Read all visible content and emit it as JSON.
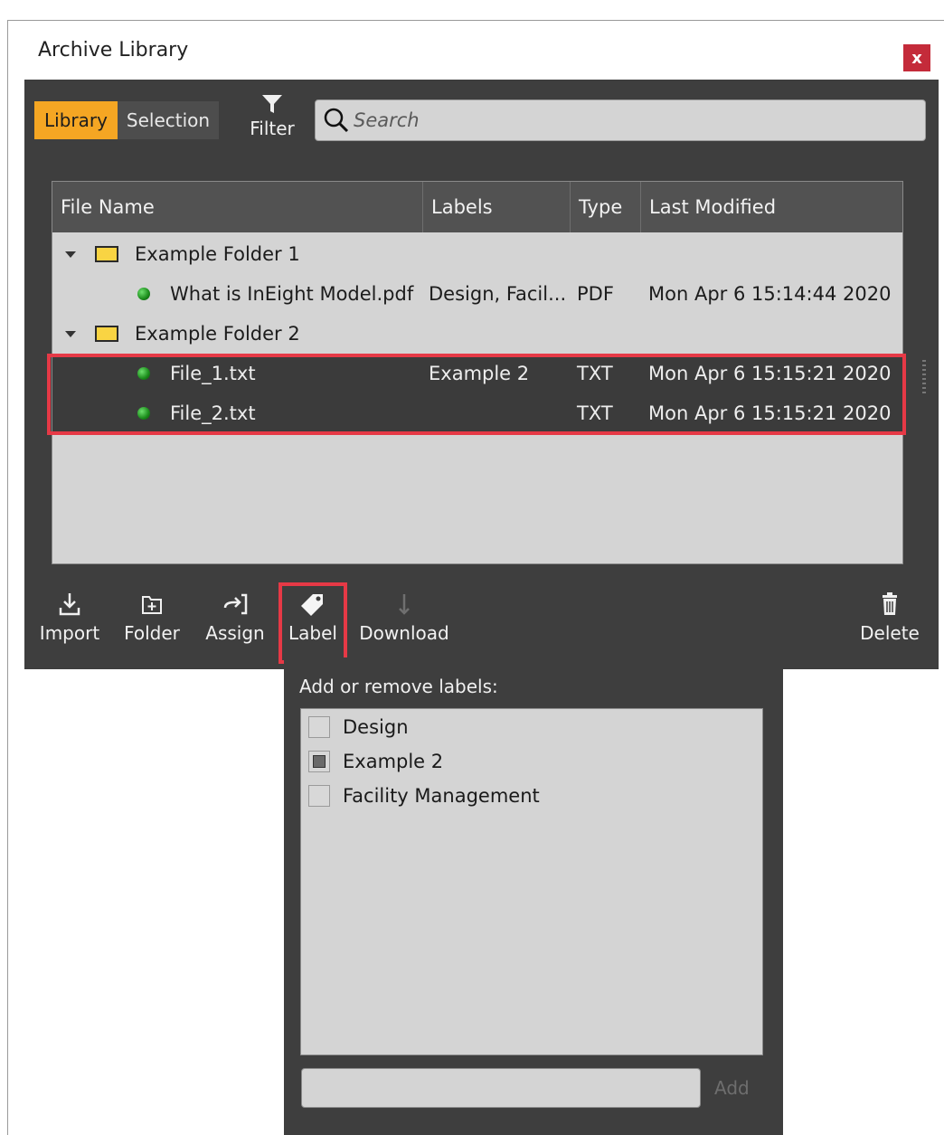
{
  "window": {
    "title": "Archive Library",
    "close_label": "x"
  },
  "tabs": [
    {
      "label": "Library",
      "active": true
    },
    {
      "label": "Selection",
      "active": false
    }
  ],
  "filter": {
    "label": "Filter",
    "icon": "filter-icon"
  },
  "search": {
    "placeholder": "Search",
    "value": ""
  },
  "table": {
    "columns": [
      "File Name",
      "Labels",
      "Type",
      "Last Modified"
    ],
    "rows": [
      {
        "kind": "folder",
        "name": "Example Folder 1",
        "labels": "",
        "type": "",
        "modified": ""
      },
      {
        "kind": "file",
        "name": "What is InEight Model.pdf",
        "labels": "Design, Facil...",
        "type": "PDF",
        "modified": "Mon Apr 6 15:14:44 2020"
      },
      {
        "kind": "folder",
        "name": "Example Folder 2",
        "labels": "",
        "type": "",
        "modified": ""
      },
      {
        "kind": "file",
        "name": "File_1.txt",
        "labels": "Example 2",
        "type": "TXT",
        "modified": "Mon Apr 6 15:15:21 2020",
        "selected": true
      },
      {
        "kind": "file",
        "name": "File_2.txt",
        "labels": "",
        "type": "TXT",
        "modified": "Mon Apr 6 15:15:21 2020",
        "selected": true
      }
    ]
  },
  "toolbar": {
    "import_label": "Import",
    "folder_label": "Folder",
    "assign_label": "Assign",
    "label_label": "Label",
    "download_label": "Download",
    "delete_label": "Delete"
  },
  "label_popup": {
    "title": "Add or remove labels:",
    "items": [
      {
        "label": "Design",
        "state": "unchecked"
      },
      {
        "label": "Example 2",
        "state": "partial"
      },
      {
        "label": "Facility Management",
        "state": "unchecked"
      }
    ],
    "input_value": "",
    "add_label": "Add"
  },
  "colors": {
    "accent": "#f5a623",
    "highlight": "#e63946",
    "panel": "#3e3e3e",
    "close": "#c42b3a"
  }
}
